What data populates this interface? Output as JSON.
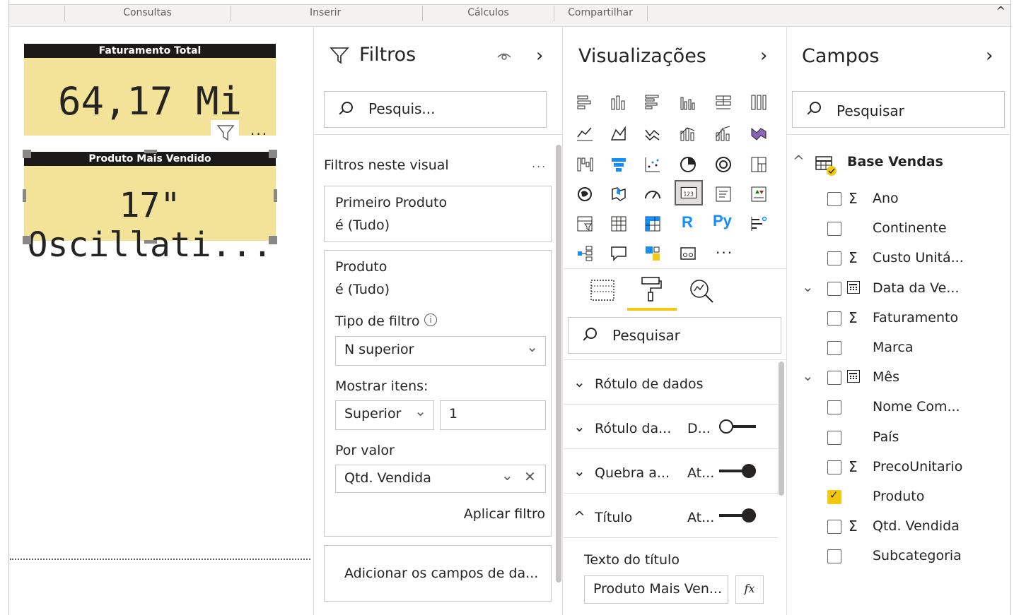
{
  "ribbon": {
    "groups": [
      "Consultas",
      "Inserir",
      "Cálculos",
      "Compartilhar"
    ],
    "collapse_glyph": "^"
  },
  "canvas": {
    "card1": {
      "title": "Faturamento Total",
      "value": "64,17 Mi"
    },
    "card2": {
      "title": "Produto Mais Vendido",
      "value": "17\" Oscillati..."
    },
    "more_glyph": "..."
  },
  "filters": {
    "title": "Filtros",
    "search_placeholder": "Pesquis...",
    "section_label": "Filtros neste visual",
    "more_glyph": "...",
    "filter1": {
      "name": "Primeiro Produto",
      "state": "é (Tudo)"
    },
    "filter2": {
      "name": "Produto",
      "state": "é (Tudo)",
      "type_label": "Tipo de filtro",
      "type_value": "N superior",
      "show_label": "Mostrar itens:",
      "show_value": "Superior",
      "show_count": "1",
      "by_value_label": "Por valor",
      "by_value_field": "Qtd. Vendida",
      "apply_label": "Aplicar filtro"
    },
    "add_fields": "Adicionar os campos de da..."
  },
  "visualizations": {
    "title": "Visualizações",
    "search_placeholder": "Pesquisar",
    "more_glyph": "...",
    "sections": [
      {
        "label": "Rótulo de dados",
        "value": "",
        "toggle": "none",
        "expanded": false
      },
      {
        "label": "Rótulo da...",
        "value": "D...",
        "toggle": "off",
        "expanded": false
      },
      {
        "label": "Quebra a...",
        "value": "At...",
        "toggle": "on",
        "expanded": false
      },
      {
        "label": "Título",
        "value": "At...",
        "toggle": "on",
        "expanded": true
      }
    ],
    "title_text_label": "Texto do título",
    "title_text_value": "Produto Mais Ven...",
    "fx_label": "fx",
    "r_label": "R",
    "py_label": "Py",
    "accent_color": "#f2c811"
  },
  "fields": {
    "title": "Campos",
    "search_placeholder": "Pesquisar",
    "table_name": "Base Vendas",
    "items": [
      {
        "name": "Ano",
        "sigma": "Σ",
        "calendar": false,
        "checked": false,
        "expandable": false
      },
      {
        "name": "Continente",
        "sigma": "",
        "calendar": false,
        "checked": false,
        "expandable": false
      },
      {
        "name": "Custo Unitá...",
        "sigma": "Σ",
        "calendar": false,
        "checked": false,
        "expandable": false
      },
      {
        "name": "Data da Ve...",
        "sigma": "",
        "calendar": true,
        "checked": false,
        "expandable": true
      },
      {
        "name": "Faturamento",
        "sigma": "Σ",
        "calendar": false,
        "checked": false,
        "expandable": false
      },
      {
        "name": "Marca",
        "sigma": "",
        "calendar": false,
        "checked": false,
        "expandable": false
      },
      {
        "name": "Mês",
        "sigma": "",
        "calendar": true,
        "checked": false,
        "expandable": true
      },
      {
        "name": "Nome Com...",
        "sigma": "",
        "calendar": false,
        "checked": false,
        "expandable": false
      },
      {
        "name": "País",
        "sigma": "",
        "calendar": false,
        "checked": false,
        "expandable": false
      },
      {
        "name": "PrecoUnitario",
        "sigma": "Σ",
        "calendar": false,
        "checked": false,
        "expandable": false
      },
      {
        "name": "Produto",
        "sigma": "",
        "calendar": false,
        "checked": true,
        "expandable": false
      },
      {
        "name": "Qtd. Vendida",
        "sigma": "Σ",
        "calendar": false,
        "checked": false,
        "expandable": false
      },
      {
        "name": "Subcategoria",
        "sigma": "",
        "calendar": false,
        "checked": false,
        "expandable": false
      }
    ]
  }
}
